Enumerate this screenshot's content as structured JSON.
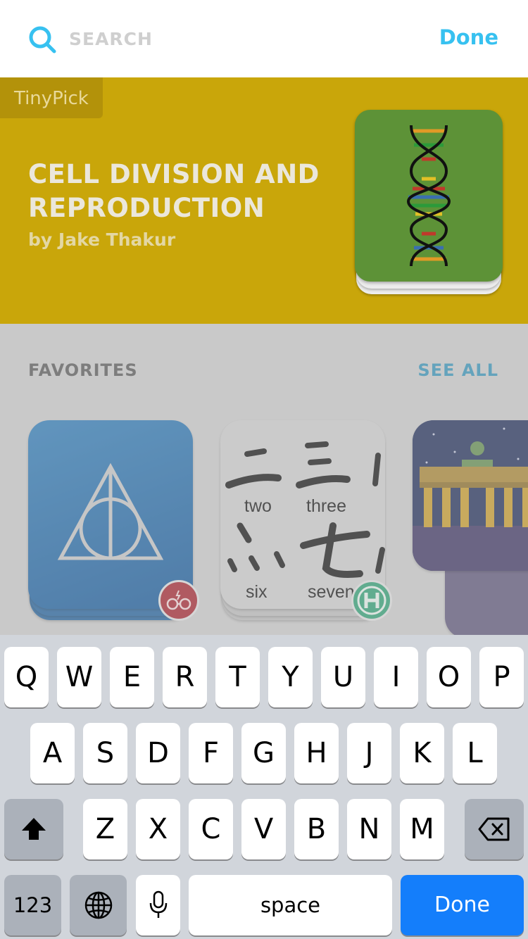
{
  "search": {
    "placeholder": "SEARCH",
    "done_label": "Done"
  },
  "banner": {
    "tag": "TinyPick",
    "title": "CELL DIVISION AND REPRODUCTION",
    "author": "by Jake Thakur",
    "colors": {
      "background": "#c9a60a",
      "card": "#5d9237"
    }
  },
  "favorites": {
    "title": "FAVORITES",
    "see_all": "SEE ALL",
    "cards": [
      {
        "name": "deathly-hallows-deck",
        "icon": "deathly-hallows-icon",
        "badge": "glasses-badge"
      },
      {
        "name": "chinese-numbers-deck",
        "icon": "chinese-numerals-icon",
        "badge": "h-badge",
        "words": [
          "two",
          "three",
          "six",
          "seven"
        ]
      },
      {
        "name": "brandenburg-gate-deck",
        "icon": "brandenburg-gate-icon"
      }
    ]
  },
  "keyboard": {
    "row1": [
      "Q",
      "W",
      "E",
      "R",
      "T",
      "Y",
      "U",
      "I",
      "O",
      "P"
    ],
    "row2": [
      "A",
      "S",
      "D",
      "F",
      "G",
      "H",
      "J",
      "K",
      "L"
    ],
    "row3": [
      "Z",
      "X",
      "C",
      "V",
      "B",
      "N",
      "M"
    ],
    "numbers_label": "123",
    "space_label": "space",
    "done_label": "Done",
    "accent": "#147efb"
  }
}
